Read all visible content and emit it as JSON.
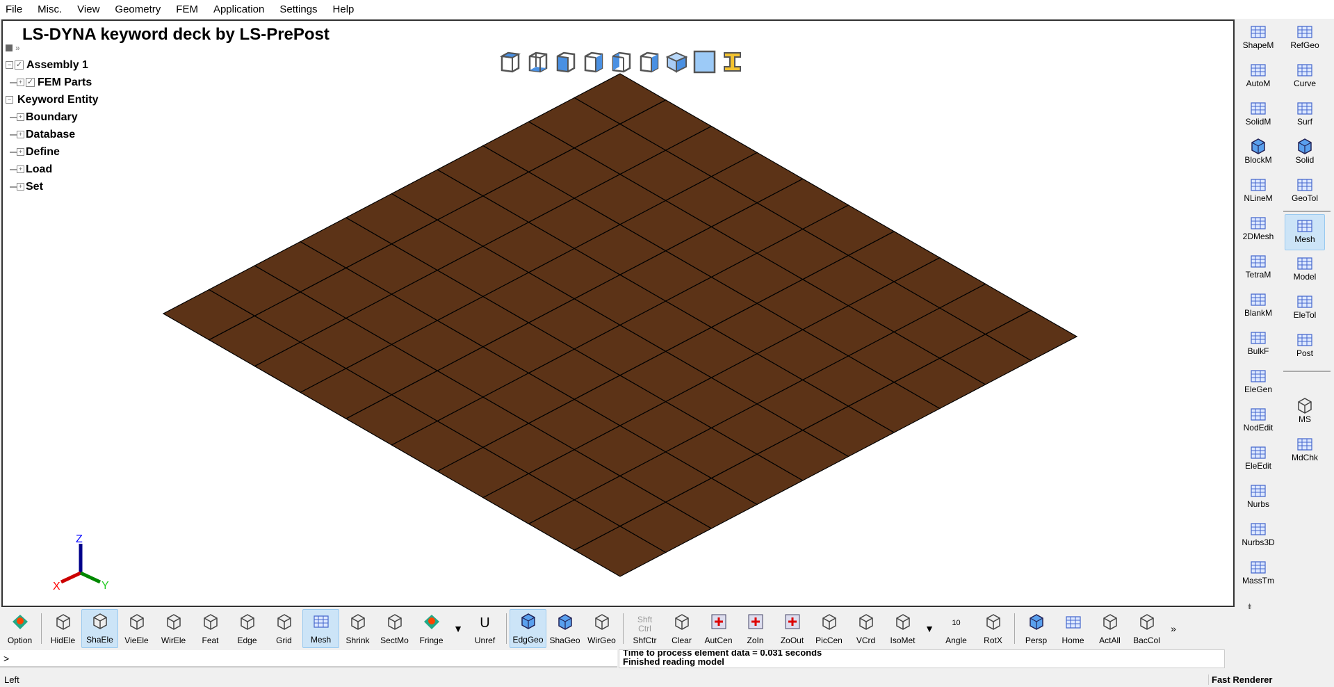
{
  "menu": [
    "File",
    "Misc.",
    "View",
    "Geometry",
    "FEM",
    "Application",
    "Settings",
    "Help"
  ],
  "viewport": {
    "title": "LS-DYNA keyword deck by LS-PrePost"
  },
  "tree": {
    "assembly": "Assembly 1",
    "fem_parts": "FEM Parts",
    "keyword_entity": "Keyword Entity",
    "children": [
      "Boundary",
      "Database",
      "Define",
      "Load",
      "Set"
    ]
  },
  "mesh": {
    "rows": 10,
    "cols": 10,
    "fill": "#5c3317",
    "edge": "#000000"
  },
  "triad": {
    "x": "X",
    "y": "Y",
    "z": "Z"
  },
  "right_panel": {
    "col1": [
      "ShapeM",
      "AutoM",
      "SolidM",
      "BlockM",
      "NLineM",
      "2DMesh",
      "TetraM",
      "BlankM",
      "BulkF",
      "EleGen",
      "NodEdit",
      "EleEdit",
      "Nurbs",
      "Nurbs3D",
      "MassTm"
    ],
    "col2": [
      "RefGeo",
      "Curve",
      "Surf",
      "Solid",
      "GeoTol",
      "Mesh",
      "Model",
      "EleTol",
      "Post",
      "MS",
      "MdChk"
    ],
    "massTm_sup": "M"
  },
  "toolbar": {
    "buttons": [
      "Option",
      "HidEle",
      "ShaEle",
      "VieEle",
      "WirEle",
      "Feat",
      "Edge",
      "Grid",
      "Mesh",
      "Shrink",
      "SectMo",
      "Fringe",
      "Unref",
      "EdgGeo",
      "ShaGeo",
      "WirGeo",
      "ShfCtr",
      "Clear",
      "AutCen",
      "ZoIn",
      "ZoOut",
      "PicCen",
      "VCrd",
      "IsoMet",
      "Angle",
      "RotX",
      "Persp",
      "Home",
      "ActAll",
      "BacCol"
    ],
    "shf_top": "Shft",
    "ctrl_top": "Ctrl",
    "angle_value": "10",
    "unref_glyph": "U"
  },
  "command": {
    "prompt": ">"
  },
  "messages": [
    "Time to process element data =  0.031 seconds",
    "Finished reading model"
  ],
  "status": {
    "left": "Left",
    "right": "Fast Renderer"
  }
}
